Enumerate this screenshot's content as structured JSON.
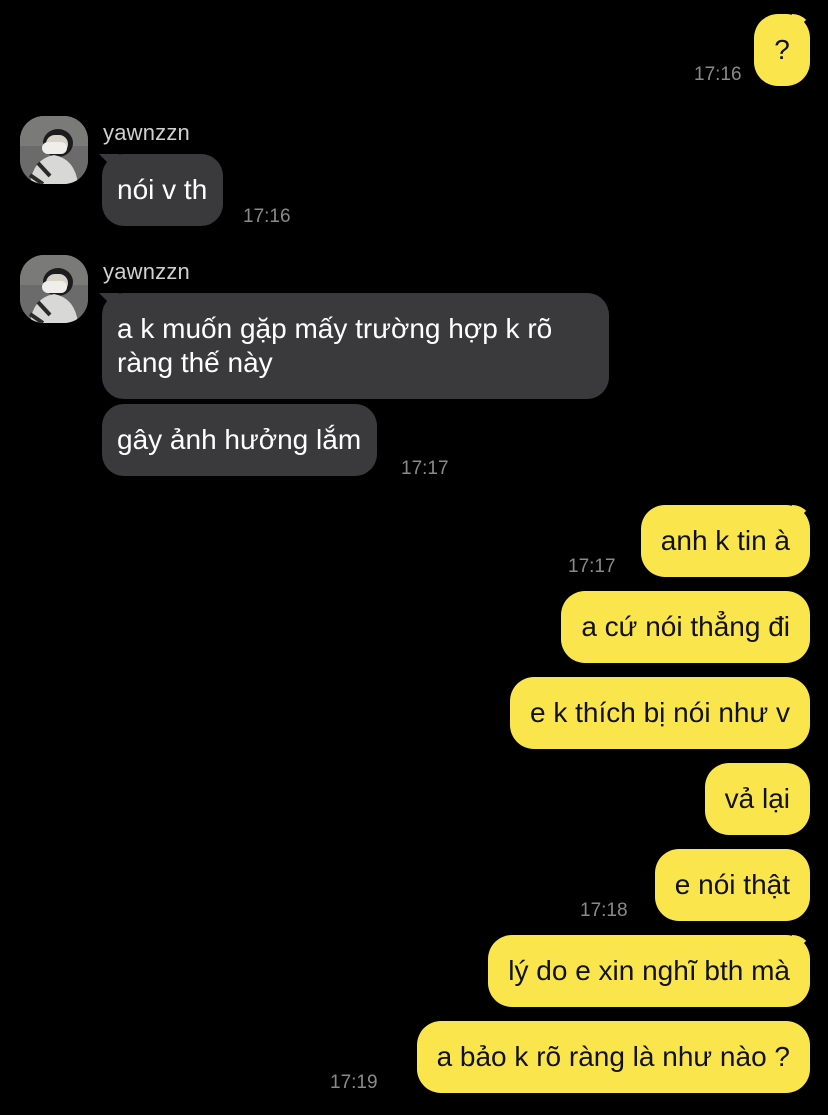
{
  "conversation": {
    "contact_name": "yawnzzn",
    "messages": [
      {
        "from": "me",
        "text": "?",
        "time": "17:16"
      },
      {
        "from": "contact",
        "sender": "yawnzzn",
        "text": "nói v th",
        "time": "17:16"
      },
      {
        "from": "contact",
        "sender": "yawnzzn",
        "text": "a k muốn gặp mấy trường hợp k rõ ràng thế này"
      },
      {
        "from": "contact",
        "text": "gây ảnh hưởng lắm",
        "time": "17:17"
      },
      {
        "from": "me",
        "text": "anh k tin à",
        "time": "17:17"
      },
      {
        "from": "me",
        "text": "a cứ nói thẳng đi"
      },
      {
        "from": "me",
        "text": "e k thích bị nói như v"
      },
      {
        "from": "me",
        "text": "vả lại"
      },
      {
        "from": "me",
        "text": "e nói thật",
        "time": "17:18"
      },
      {
        "from": "me",
        "text": "lý do e xin nghĩ bth mà"
      },
      {
        "from": "me",
        "text": "a bảo k rõ ràng là như nào ?",
        "time": "17:19"
      }
    ]
  },
  "colors": {
    "background": "#000000",
    "outgoing_bubble": "#fae64c",
    "incoming_bubble": "#3a3a3c",
    "timestamp": "#8a8a8a"
  },
  "icons": {
    "avatar": "user-avatar-photo"
  }
}
